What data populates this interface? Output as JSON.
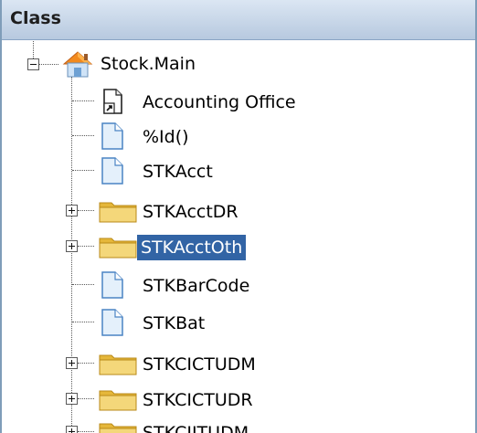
{
  "header": {
    "title": "Class"
  },
  "tree": {
    "root": {
      "label": "Stock.Main",
      "expanded": true,
      "icon": "home-icon"
    },
    "items": [
      {
        "label": "Accounting Office",
        "type": "shortcut",
        "icon": "shortcut-file-icon"
      },
      {
        "label": "%Id()",
        "type": "file",
        "icon": "document-icon"
      },
      {
        "label": "STKAcct",
        "type": "file",
        "icon": "document-icon"
      },
      {
        "label": "STKAcctDR",
        "type": "folder",
        "icon": "folder-icon",
        "expandable": true
      },
      {
        "label": "STKAcctOth",
        "type": "folder",
        "icon": "folder-icon",
        "expandable": true,
        "selected": true
      },
      {
        "label": "STKBarCode",
        "type": "file",
        "icon": "document-icon"
      },
      {
        "label": "STKBat",
        "type": "file",
        "icon": "document-icon"
      },
      {
        "label": "STKCICTUDM",
        "type": "folder",
        "icon": "folder-icon",
        "expandable": true
      },
      {
        "label": "STKCICTUDR",
        "type": "folder",
        "icon": "folder-icon",
        "expandable": true
      },
      {
        "label": "STKCIITUDM",
        "type": "folder",
        "icon": "folder-icon",
        "expandable": true
      }
    ]
  },
  "colors": {
    "header_bg": "#c9d8ea",
    "selection_bg": "#3264a5",
    "selection_text": "#ffffff",
    "folder": "#f2c94c",
    "document": "#dbeaf9"
  }
}
